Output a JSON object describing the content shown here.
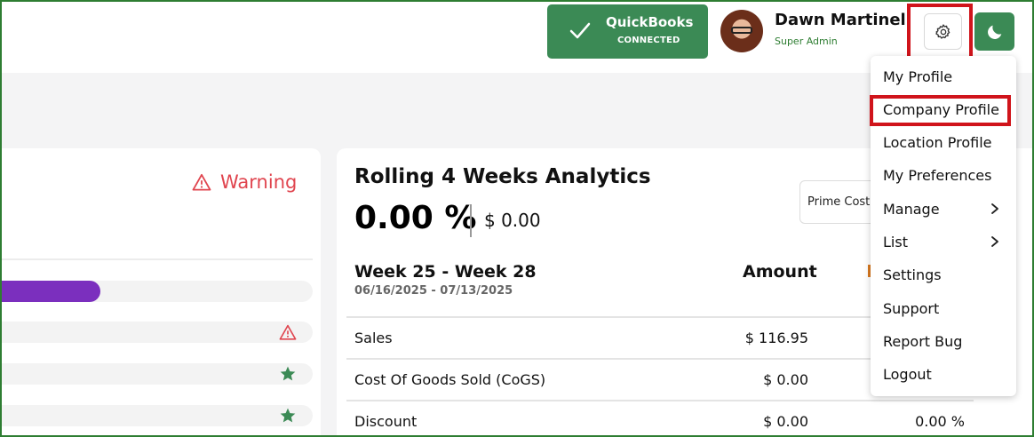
{
  "header": {
    "quickbooks": {
      "title": "QuickBooks",
      "status": "CONNECTED",
      "icon": "check-icon",
      "color": "#3b8a55"
    },
    "user": {
      "name": "Dawn Martinello",
      "role": "Super Admin"
    },
    "settings_icon": "gear-icon",
    "theme_icon": "moon-icon"
  },
  "settings_menu": {
    "items": [
      {
        "label": "My Profile"
      },
      {
        "label": "Company Profile"
      },
      {
        "label": "Location Profile"
      },
      {
        "label": "My Preferences"
      },
      {
        "label": "Manage",
        "has_submenu": true
      },
      {
        "label": "List",
        "has_submenu": true
      },
      {
        "label": "Settings"
      },
      {
        "label": "Support"
      },
      {
        "label": "Report Bug"
      },
      {
        "label": "Logout"
      }
    ],
    "highlighted": "Company Profile"
  },
  "left_card": {
    "warning_label": "Warning",
    "progress_percent": 32,
    "progress_color": "#7b2fbe",
    "row_icons": [
      "warning-icon",
      "star-icon",
      "star-icon"
    ]
  },
  "analytics": {
    "title": "Rolling 4 Weeks Analytics",
    "percent": "0.00 %",
    "amount": "$ 0.00",
    "filter_value": "Prime Cost",
    "period_title": "Week 25 - Week 28",
    "period_dates": "06/16/2025 - 07/13/2025",
    "amount_header": "Amount",
    "rows": [
      {
        "label": "Sales",
        "amount": "$ 116.95",
        "percent": ""
      },
      {
        "label": "Cost Of Goods Sold (CoGS)",
        "amount": "$ 0.00",
        "percent": ""
      },
      {
        "label": "Discount",
        "amount": "$ 0.00",
        "percent": "0.00 %"
      }
    ]
  },
  "colors": {
    "accent_green": "#3b8a55",
    "warning_red": "#e0454f",
    "highlight_red": "#d0141b"
  }
}
